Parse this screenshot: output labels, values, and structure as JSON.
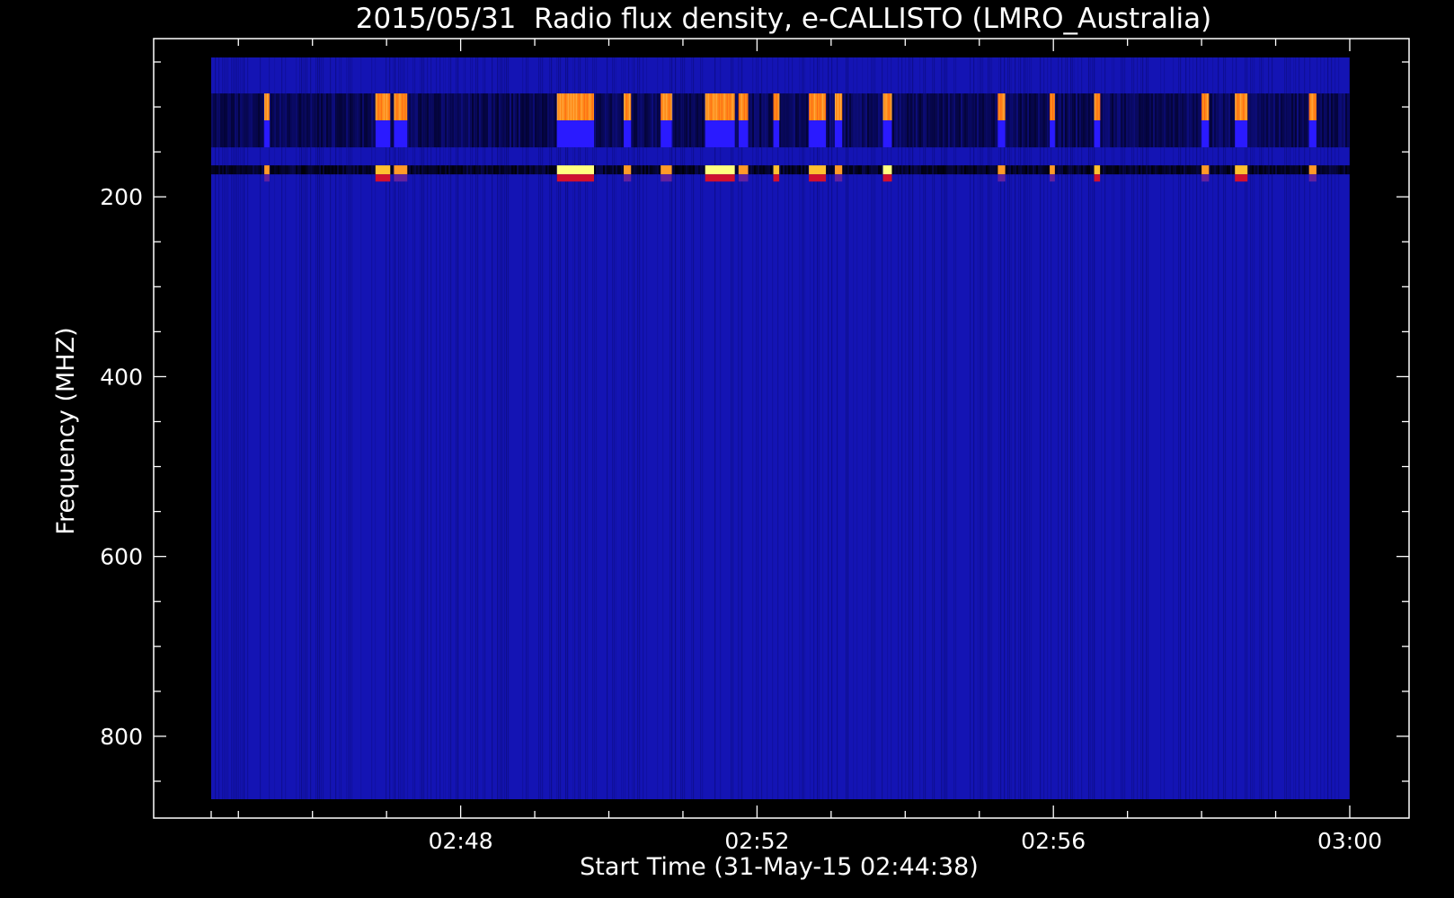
{
  "chart_data": {
    "type": "heatmap",
    "title": "2015/05/31  Radio flux density, e-CALLISTO (LMRO_Australia)",
    "xlabel": "Start Time (31-May-15 02:44:38)",
    "ylabel": "Frequency (MHZ)",
    "x_range_minutes": [
      44.633,
      60.0
    ],
    "ylim": [
      45,
      870
    ],
    "y_inverted": true,
    "data_range_freq_mhz": [
      45,
      870
    ],
    "x_ticks": [
      {
        "minute": 48,
        "label": "02:48"
      },
      {
        "minute": 52,
        "label": "02:52"
      },
      {
        "minute": 56,
        "label": "02:56"
      },
      {
        "minute": 60,
        "label": "03:00"
      }
    ],
    "y_ticks": [
      {
        "value": 200,
        "label": "200"
      },
      {
        "value": 400,
        "label": "400"
      },
      {
        "value": 600,
        "label": "600"
      },
      {
        "value": 800,
        "label": "800"
      }
    ],
    "colormap": [
      "#000010",
      "#1010c8",
      "#ff8c1a",
      "#ffff66",
      "#ffffff"
    ],
    "background_color": "#1414b4",
    "grid": false,
    "band_rows_mhz": {
      "bright": [
        85,
        115
      ],
      "mid": [
        115,
        145
      ],
      "narrow_line": [
        165,
        175
      ],
      "below_line": [
        175,
        183
      ]
    },
    "bursts": [
      {
        "start_minute": 45.35,
        "end_minute": 45.42,
        "intensity": 0.8
      },
      {
        "start_minute": 46.85,
        "end_minute": 47.05,
        "intensity": 0.9
      },
      {
        "start_minute": 47.1,
        "end_minute": 47.28,
        "intensity": 0.85
      },
      {
        "start_minute": 49.3,
        "end_minute": 49.8,
        "intensity": 0.95
      },
      {
        "start_minute": 50.2,
        "end_minute": 50.3,
        "intensity": 0.8
      },
      {
        "start_minute": 50.7,
        "end_minute": 50.85,
        "intensity": 0.8
      },
      {
        "start_minute": 51.3,
        "end_minute": 51.7,
        "intensity": 1.0
      },
      {
        "start_minute": 51.75,
        "end_minute": 51.88,
        "intensity": 0.85
      },
      {
        "start_minute": 52.22,
        "end_minute": 52.3,
        "intensity": 0.9
      },
      {
        "start_minute": 52.7,
        "end_minute": 52.93,
        "intensity": 0.9
      },
      {
        "start_minute": 53.05,
        "end_minute": 53.15,
        "intensity": 0.85
      },
      {
        "start_minute": 53.7,
        "end_minute": 53.82,
        "intensity": 0.95
      },
      {
        "start_minute": 55.25,
        "end_minute": 55.35,
        "intensity": 0.85
      },
      {
        "start_minute": 55.95,
        "end_minute": 56.02,
        "intensity": 0.8
      },
      {
        "start_minute": 56.55,
        "end_minute": 56.63,
        "intensity": 0.9
      },
      {
        "start_minute": 58.0,
        "end_minute": 58.1,
        "intensity": 0.85
      },
      {
        "start_minute": 58.45,
        "end_minute": 58.62,
        "intensity": 0.9
      },
      {
        "start_minute": 59.45,
        "end_minute": 59.55,
        "intensity": 0.85
      }
    ]
  }
}
